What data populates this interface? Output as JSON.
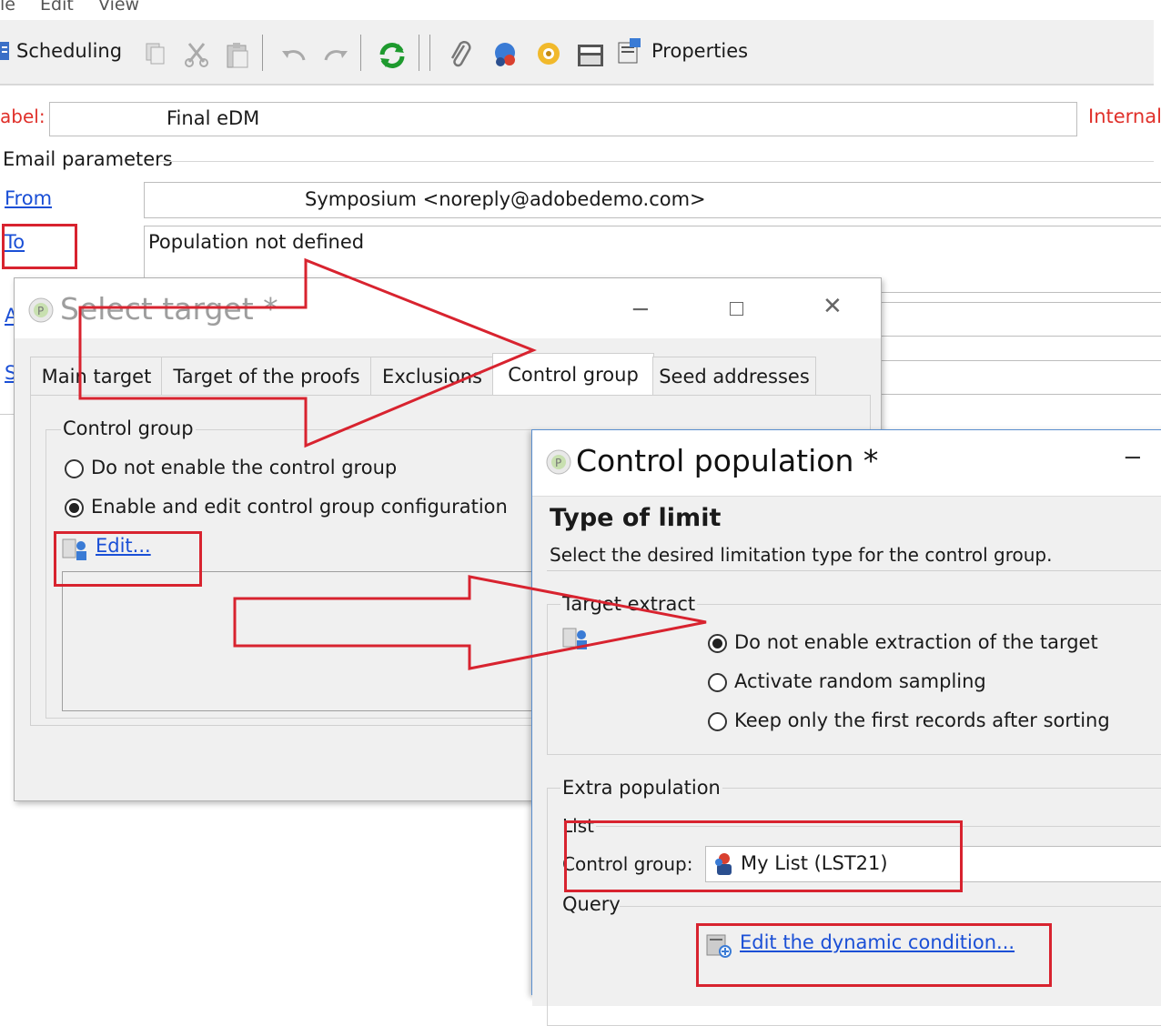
{
  "menu": {
    "file": "le",
    "edit": "Edit",
    "view": "View"
  },
  "toolbar": {
    "scheduling": "Scheduling",
    "properties": "Properties"
  },
  "form": {
    "label_caption": "abel:",
    "label_value": "Final eDM",
    "internal_caption": "Internal",
    "email_parameters": "Email parameters",
    "from_link": "From",
    "from_value": "Symposium <noreply@adobedemo.com>",
    "to_link": "To",
    "to_value": "Population not defined",
    "a_link": "A",
    "s_link": "S"
  },
  "select_target": {
    "title": "Select target *",
    "tabs": [
      "Main target",
      "Target of the proofs",
      "Exclusions",
      "Control group",
      "Seed addresses"
    ],
    "group_title": "Control group",
    "option_disable": "Do not enable the control group",
    "option_enable": "Enable and edit control group configuration",
    "edit_link": "Edit..."
  },
  "control_population": {
    "title": "Control population *",
    "heading": "Type of limit",
    "subheading": "Select the desired limitation type for the control group.",
    "target_extract": "Target extract",
    "opt_no_extract": "Do not enable extraction of the target",
    "opt_random": "Activate random sampling",
    "opt_first": "Keep only the first records after sorting",
    "extra_population": "Extra population",
    "list_label": "List",
    "control_group_label": "Control group:",
    "control_group_value": "My List (LST21)",
    "query_label": "Query",
    "edit_condition_link": "Edit the dynamic condition..."
  },
  "colors": {
    "annotation_red": "#d8232f",
    "link_blue": "#1a4fd6",
    "internal_red": "#e0302a"
  }
}
